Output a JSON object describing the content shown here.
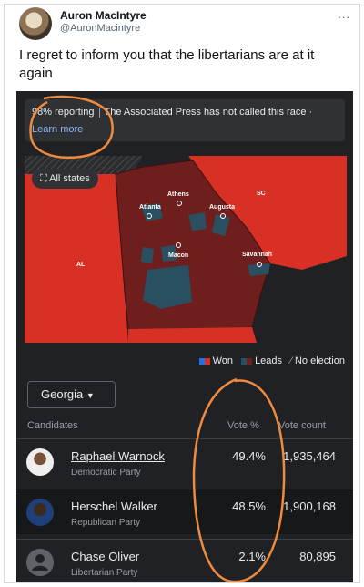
{
  "tweet": {
    "display_name": "Auron MacIntyre",
    "handle": "@AuronMacintyre",
    "more_icon": "...",
    "text": "I regret to inform you that the libertarians are at it again"
  },
  "results": {
    "banner": {
      "reporting": "98% reporting",
      "notice": "The Associated Press has not called this race",
      "learn_more": "Learn more"
    },
    "all_states_label": "All states",
    "map_labels": {
      "athens": "Athens",
      "atlanta": "Atlanta",
      "augusta": "Augusta",
      "macon": "Macon",
      "savannah": "Savannah",
      "sc": "SC",
      "al": "AL"
    },
    "legend": {
      "won": "Won",
      "leads": "Leads",
      "no_election": "No election"
    },
    "state_selector": "Georgia",
    "columns": {
      "candidates": "Candidates",
      "vote_pct": "Vote %",
      "vote_count": "Vote count"
    },
    "candidates": [
      {
        "name": "Raphael Warnock",
        "party": "Democratic Party",
        "pct": "49.4%",
        "count": "1,935,464"
      },
      {
        "name": "Herschel Walker",
        "party": "Republican Party",
        "pct": "48.5%",
        "count": "1,900,168"
      },
      {
        "name": "Chase Oliver",
        "party": "Libertarian Party",
        "pct": "2.1%",
        "count": "80,895"
      }
    ]
  },
  "colors": {
    "dem_won": "#1a73e8",
    "rep_won": "#d93025",
    "leads_rep": "#6e1f1d",
    "leads_dem": "#2a4f60",
    "annotation": "#f08a3c"
  }
}
